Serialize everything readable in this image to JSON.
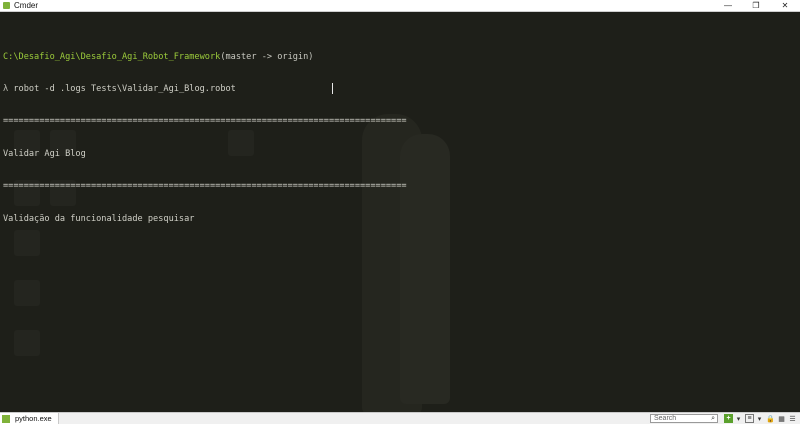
{
  "window": {
    "title": "Cmder"
  },
  "controls": {
    "minimize": "—",
    "maximize": "❐",
    "close": "✕"
  },
  "terminal": {
    "path": "C:\\Desafio_Agi\\Desafio_Agi_Robot_Framework",
    "branch": "(master -> origin)",
    "prompt_symbol": "λ",
    "command": "robot -d .logs Tests\\Validar_Agi_Blog.robot",
    "separator": "==============================================================================",
    "suite_name": "Validar Agi Blog",
    "test_name": "Validação da funcionalidade pesquisar"
  },
  "statusbar": {
    "tab_label": "python.exe",
    "search_placeholder": "Search",
    "icons": [
      "search-icon",
      "plus-icon",
      "chevron-down-icon",
      "list-icon",
      "chevron-down-icon",
      "lock-icon",
      "grid-icon",
      "menu-icon"
    ]
  },
  "colors": {
    "path": "#9ccc3b",
    "background": "#1e1f19",
    "accent": "#7fb23a"
  }
}
